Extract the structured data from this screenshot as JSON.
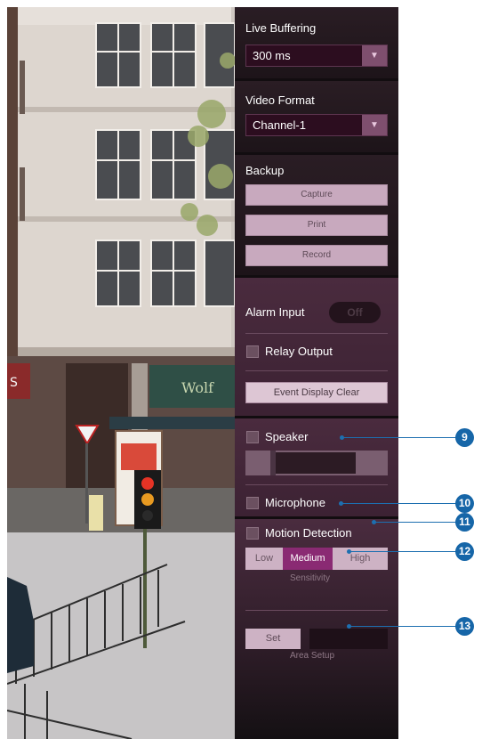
{
  "camera": {
    "sign_left": "S",
    "sign_shop": "Wolf"
  },
  "live_buffering": {
    "label": "Live Buffering",
    "value": "300 ms"
  },
  "video_format": {
    "label": "Video Format",
    "value": "Channel-1"
  },
  "backup": {
    "label": "Backup",
    "capture": "Capture",
    "print": "Print",
    "record": "Record"
  },
  "alarm": {
    "alarm_input_label": "Alarm Input",
    "alarm_input_state": "Off",
    "relay_output_label": "Relay Output",
    "event_display_clear": "Event Display Clear"
  },
  "audio": {
    "speaker_label": "Speaker",
    "microphone_label": "Microphone"
  },
  "motion": {
    "label": "Motion Detection",
    "sensitivity_options": [
      "Low",
      "Medium",
      "High"
    ],
    "selected_sensitivity": "Medium",
    "sensitivity_label": "Sensitivity",
    "set_button": "Set",
    "area_setup_label": "Area Setup"
  },
  "callouts": [
    "9",
    "10",
    "11",
    "12",
    "13"
  ],
  "colors": {
    "accent": "#8a2a73",
    "callout": "#1666a8",
    "panel": "#1b1417"
  },
  "icons": {
    "dropdown": "chevron-down-icon"
  }
}
